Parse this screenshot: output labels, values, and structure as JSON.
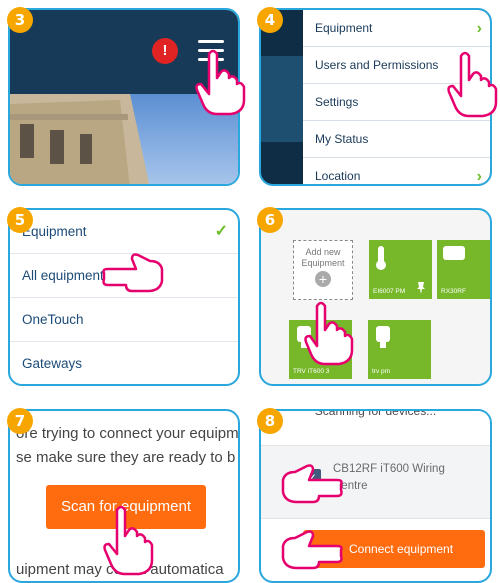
{
  "steps": [
    "3",
    "4",
    "5",
    "6",
    "7",
    "8"
  ],
  "panel3": {
    "alert_symbol": "!"
  },
  "panel4": {
    "menu": [
      {
        "label": "Equipment",
        "chevron": true
      },
      {
        "label": "Users and Permissions",
        "chevron": false
      },
      {
        "label": "Settings",
        "chevron": true
      },
      {
        "label": "My Status",
        "chevron": false
      },
      {
        "label": "Location",
        "chevron": true
      }
    ]
  },
  "panel5": {
    "items": [
      "Equipment",
      "All equipment",
      "OneTouch",
      "Gateways"
    ]
  },
  "panel6": {
    "add_new": "Add new Equipment",
    "tiles": [
      {
        "label": "EI6007 PM"
      },
      {
        "label": "RX30RF"
      },
      {
        "label": "TRV iT600 3"
      },
      {
        "label": "trv pm"
      }
    ]
  },
  "panel7": {
    "text_line1": "ore trying to connect your equipm",
    "text_line2": "se make sure they are ready to b",
    "scan_button": "Scan for equipment",
    "text_bottom": "uipment may co    ect automatica"
  },
  "panel8": {
    "header": "Scanning for devices...",
    "device_name": "CB12RF iT600 Wiring Centre",
    "connect_button": "Connect equipment"
  },
  "colors": {
    "border": "#2aa7dc",
    "step_badge": "#f7a600",
    "navy": "#173a58",
    "alert": "#e02424",
    "green": "#77b82b",
    "orange": "#ff6b0f"
  }
}
